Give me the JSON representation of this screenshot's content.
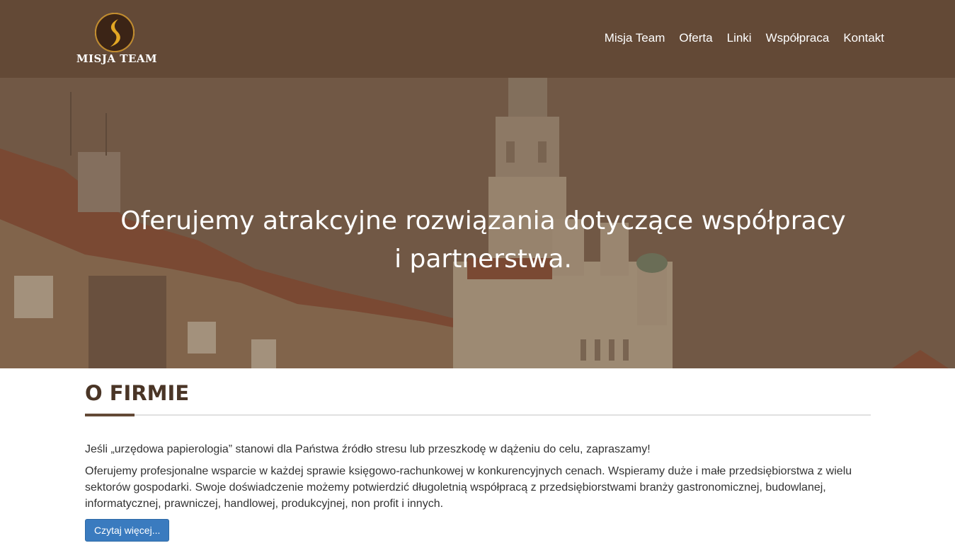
{
  "brand": {
    "name": "MISJA TEAM",
    "logo_icon": "s-flame-logo-icon"
  },
  "nav": {
    "items": [
      {
        "label": "Misja Team"
      },
      {
        "label": "Oferta"
      },
      {
        "label": "Linki"
      },
      {
        "label": "Współpraca"
      },
      {
        "label": "Kontakt"
      }
    ]
  },
  "hero": {
    "title": "Oferujemy atrakcyjne rozwiązania dotyczące współpracy i partnerstwa."
  },
  "about": {
    "title": "O FIRMIE",
    "p1": "Jeśli „urzędowa papierologia” stanowi dla Państwa źródło stresu lub przeszkodę w dążeniu do celu, zapraszamy!",
    "p2": "Oferujemy profesjonalne wsparcie w każdej sprawie księgowo-rachunkowej w konkurencyjnych cenach. Wspieramy duże i małe przedsiębiorstwa z wielu sektorów gospodarki. Swoje doświadczenie możemy potwierdzić długoletnią współpracą z przedsiębiorstwami branży gastronomicznej, budowlanej, informatycznej, prawniczej, handlowej, produkcyjnej, non profit i innych.",
    "button": "Czytaj więcej..."
  },
  "colors": {
    "header_bg": "#634936",
    "accent": "#634936",
    "button_bg": "#3a7bbf"
  }
}
